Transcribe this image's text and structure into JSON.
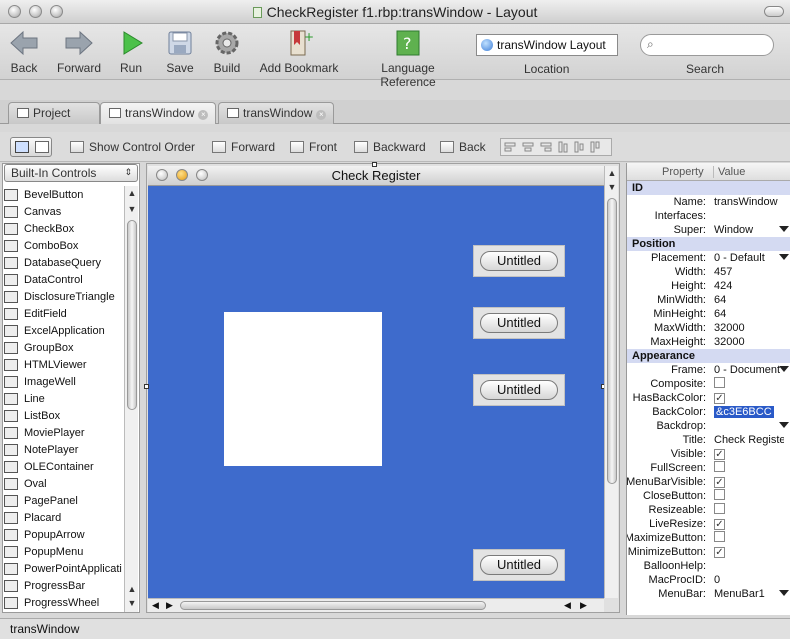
{
  "window": {
    "title": "CheckRegister f1.rbp:transWindow - Layout"
  },
  "toolbar": {
    "back": "Back",
    "forward": "Forward",
    "run": "Run",
    "save": "Save",
    "build": "Build",
    "add_bookmark": "Add Bookmark",
    "language_reference": "Language Reference",
    "location_value": "transWindow Layout",
    "location_label": "Location",
    "search_label": "Search"
  },
  "tabs": [
    {
      "label": "Project"
    },
    {
      "label": "transWindow"
    },
    {
      "label": "transWindow"
    }
  ],
  "control_bar": {
    "show_control_order": "Show Control Order",
    "forward": "Forward",
    "front": "Front",
    "backward": "Backward",
    "back": "Back"
  },
  "library": {
    "dropdown": "Built-In Controls",
    "items": [
      "BevelButton",
      "Canvas",
      "CheckBox",
      "ComboBox",
      "DatabaseQuery",
      "DataControl",
      "DisclosureTriangle",
      "EditField",
      "ExcelApplication",
      "GroupBox",
      "HTMLViewer",
      "ImageWell",
      "Line",
      "ListBox",
      "MoviePlayer",
      "NotePlayer",
      "OLEContainer",
      "Oval",
      "PagePanel",
      "Placard",
      "PopupArrow",
      "PopupMenu",
      "PowerPointApplicati...",
      "ProgressBar",
      "ProgressWheel"
    ]
  },
  "editor": {
    "window_title": "Check Register",
    "back_color": "#3e6bcc",
    "buttons": [
      {
        "label": "Untitled"
      },
      {
        "label": "Untitled"
      },
      {
        "label": "Untitled"
      },
      {
        "label": "Untitled"
      }
    ]
  },
  "properties": {
    "header_property": "Property",
    "header_value": "Value",
    "groups": [
      {
        "name": "ID",
        "rows": [
          {
            "key": "Name:",
            "value": "transWindow"
          },
          {
            "key": "Interfaces:",
            "value": ""
          },
          {
            "key": "Super:",
            "value": "Window"
          }
        ]
      },
      {
        "name": "Position",
        "rows": [
          {
            "key": "Placement:",
            "value": "0 - Default"
          },
          {
            "key": "Width:",
            "value": "457"
          },
          {
            "key": "Height:",
            "value": "424"
          },
          {
            "key": "MinWidth:",
            "value": "64"
          },
          {
            "key": "MinHeight:",
            "value": "64"
          },
          {
            "key": "MaxWidth:",
            "value": "32000"
          },
          {
            "key": "MaxHeight:",
            "value": "32000"
          }
        ]
      },
      {
        "name": "Appearance",
        "rows": [
          {
            "key": "Frame:",
            "value": "0 - Document"
          },
          {
            "key": "Composite:",
            "value": ""
          },
          {
            "key": "HasBackColor:",
            "value": ""
          },
          {
            "key": "BackColor:",
            "value": "&c3E6BCC"
          },
          {
            "key": "Backdrop:",
            "value": ""
          },
          {
            "key": "Title:",
            "value": "Check Register"
          },
          {
            "key": "Visible:",
            "value": ""
          },
          {
            "key": "FullScreen:",
            "value": ""
          },
          {
            "key": "MenuBarVisible:",
            "value": ""
          },
          {
            "key": "CloseButton:",
            "value": ""
          },
          {
            "key": "Resizeable:",
            "value": ""
          },
          {
            "key": "LiveResize:",
            "value": ""
          },
          {
            "key": "MaximizeButton:",
            "value": ""
          },
          {
            "key": "MinimizeButton:",
            "value": ""
          },
          {
            "key": "BalloonHelp:",
            "value": ""
          },
          {
            "key": "MacProcID:",
            "value": "0"
          },
          {
            "key": "MenuBar:",
            "value": "MenuBar1"
          }
        ]
      }
    ],
    "checks": {
      "Composite:": false,
      "HasBackColor:": true,
      "Visible:": true,
      "FullScreen:": false,
      "MenuBarVisible:": true,
      "CloseButton:": false,
      "Resizeable:": false,
      "LiveResize:": true,
      "MaximizeButton:": false,
      "MinimizeButton:": true
    }
  },
  "status": {
    "text": "transWindow"
  }
}
